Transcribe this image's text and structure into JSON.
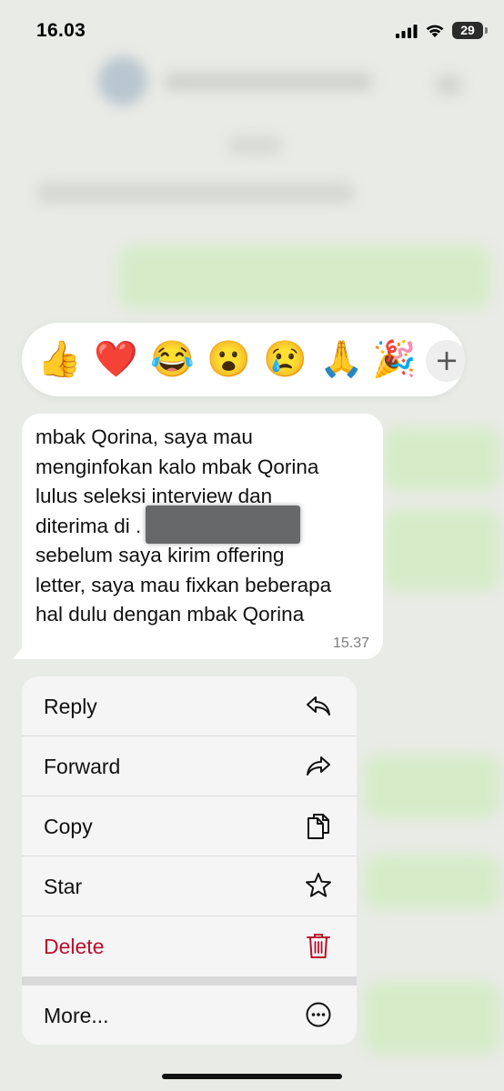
{
  "status_bar": {
    "time": "16.03",
    "battery": "29"
  },
  "reactions": [
    {
      "emoji": "👍",
      "icon": "thumbs-up"
    },
    {
      "emoji": "❤️",
      "icon": "red-heart"
    },
    {
      "emoji": "😂",
      "icon": "tears-of-joy"
    },
    {
      "emoji": "😮",
      "icon": "surprised-face"
    },
    {
      "emoji": "😢",
      "icon": "crying-face"
    },
    {
      "emoji": "🙏",
      "icon": "folded-hands"
    },
    {
      "emoji": "🎉",
      "icon": "party-popper"
    }
  ],
  "add_reaction_label": "+",
  "message": {
    "text": "mbak Qorina, saya mau\nmenginfokan kalo mbak Qorina\nlulus seleksi interview dan\nditerima di                        .\nsebelum saya kirim offering\nletter, saya mau fixkan beberapa\nhal dulu dengan mbak Qorina",
    "time": "15.37"
  },
  "menu": {
    "reply": "Reply",
    "forward": "Forward",
    "copy": "Copy",
    "star": "Star",
    "delete": "Delete",
    "more": "More..."
  },
  "colors": {
    "delete": "#b8102f",
    "bubble": "#ffffff",
    "background": "#e9ebe6"
  }
}
